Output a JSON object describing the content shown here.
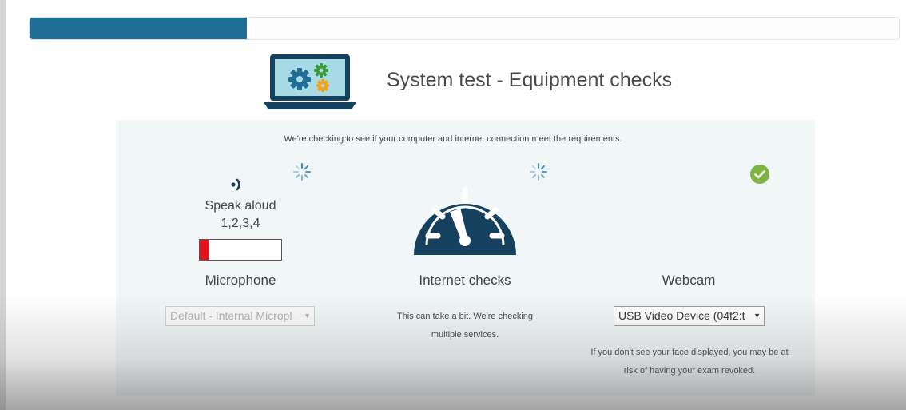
{
  "progress": {
    "fraction": 0.25,
    "color": "#1f6e98"
  },
  "header": {
    "title": "System test - Equipment checks",
    "icon": "laptop-gears-icon"
  },
  "intro": "We're checking to see if your computer and internet connection meet the requirements.",
  "microphone": {
    "instruction_line1": "Speak aloud",
    "instruction_line2": "1,2,3,4",
    "label": "Microphone",
    "level_fraction": 0.12,
    "level_color": "#e0141e",
    "status_icon": "loading-spinner-icon",
    "select_value": "Default - Internal Micropl"
  },
  "internet": {
    "label": "Internet checks",
    "note_line1": "This can take a bit. We're checking",
    "note_line2": "multiple services.",
    "status_icon": "loading-spinner-icon",
    "icon": "speedometer-icon"
  },
  "webcam": {
    "label": "Webcam",
    "select_value": "USB Video Device (04f2:t",
    "note_line1": "If you don't see your face displayed, you may be at",
    "note_line2": "risk of having your exam revoked.",
    "status_icon": "check-circle-icon",
    "status_color": "#7cb342"
  }
}
